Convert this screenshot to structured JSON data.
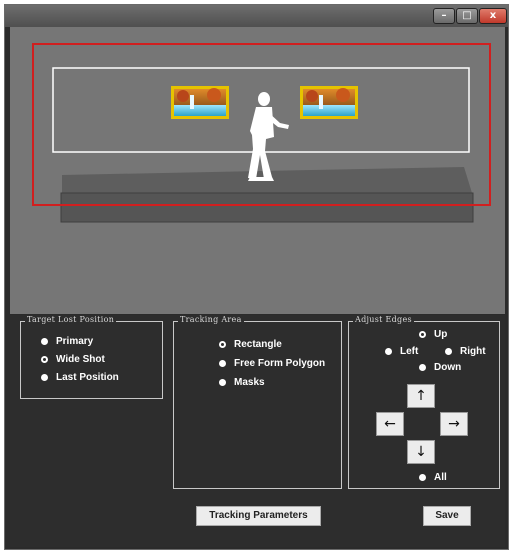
{
  "window": {
    "buttons": {
      "minimize": "–",
      "maximize": "□",
      "close": "x"
    }
  },
  "scene": {
    "colors": {
      "background": "#767676",
      "tracking_rect": "#d11f1f",
      "edges": "#ffffff",
      "picture_frame": "#e6c300"
    }
  },
  "target_lost": {
    "title": "Target Lost Position",
    "options": [
      {
        "label": "Primary",
        "selected": false
      },
      {
        "label": "Wide Shot",
        "selected": true
      },
      {
        "label": "Last Position",
        "selected": false
      }
    ]
  },
  "tracking_area": {
    "title": "Tracking Area",
    "options": [
      {
        "label": "Rectangle",
        "selected": true
      },
      {
        "label": "Free Form Polygon",
        "selected": false
      },
      {
        "label": "Masks",
        "selected": false
      }
    ]
  },
  "adjust_edges": {
    "title": "Adjust Edges",
    "options": [
      {
        "label": "Up",
        "selected": true
      },
      {
        "label": "Left",
        "selected": false
      },
      {
        "label": "Right",
        "selected": false
      },
      {
        "label": "Down",
        "selected": false
      },
      {
        "label": "All",
        "selected": false
      }
    ],
    "arrows": {
      "up": "↑",
      "left": "←",
      "right": "→",
      "down": "↓"
    }
  },
  "buttons": {
    "tracking_parameters": "Tracking Parameters",
    "save": "Save"
  }
}
